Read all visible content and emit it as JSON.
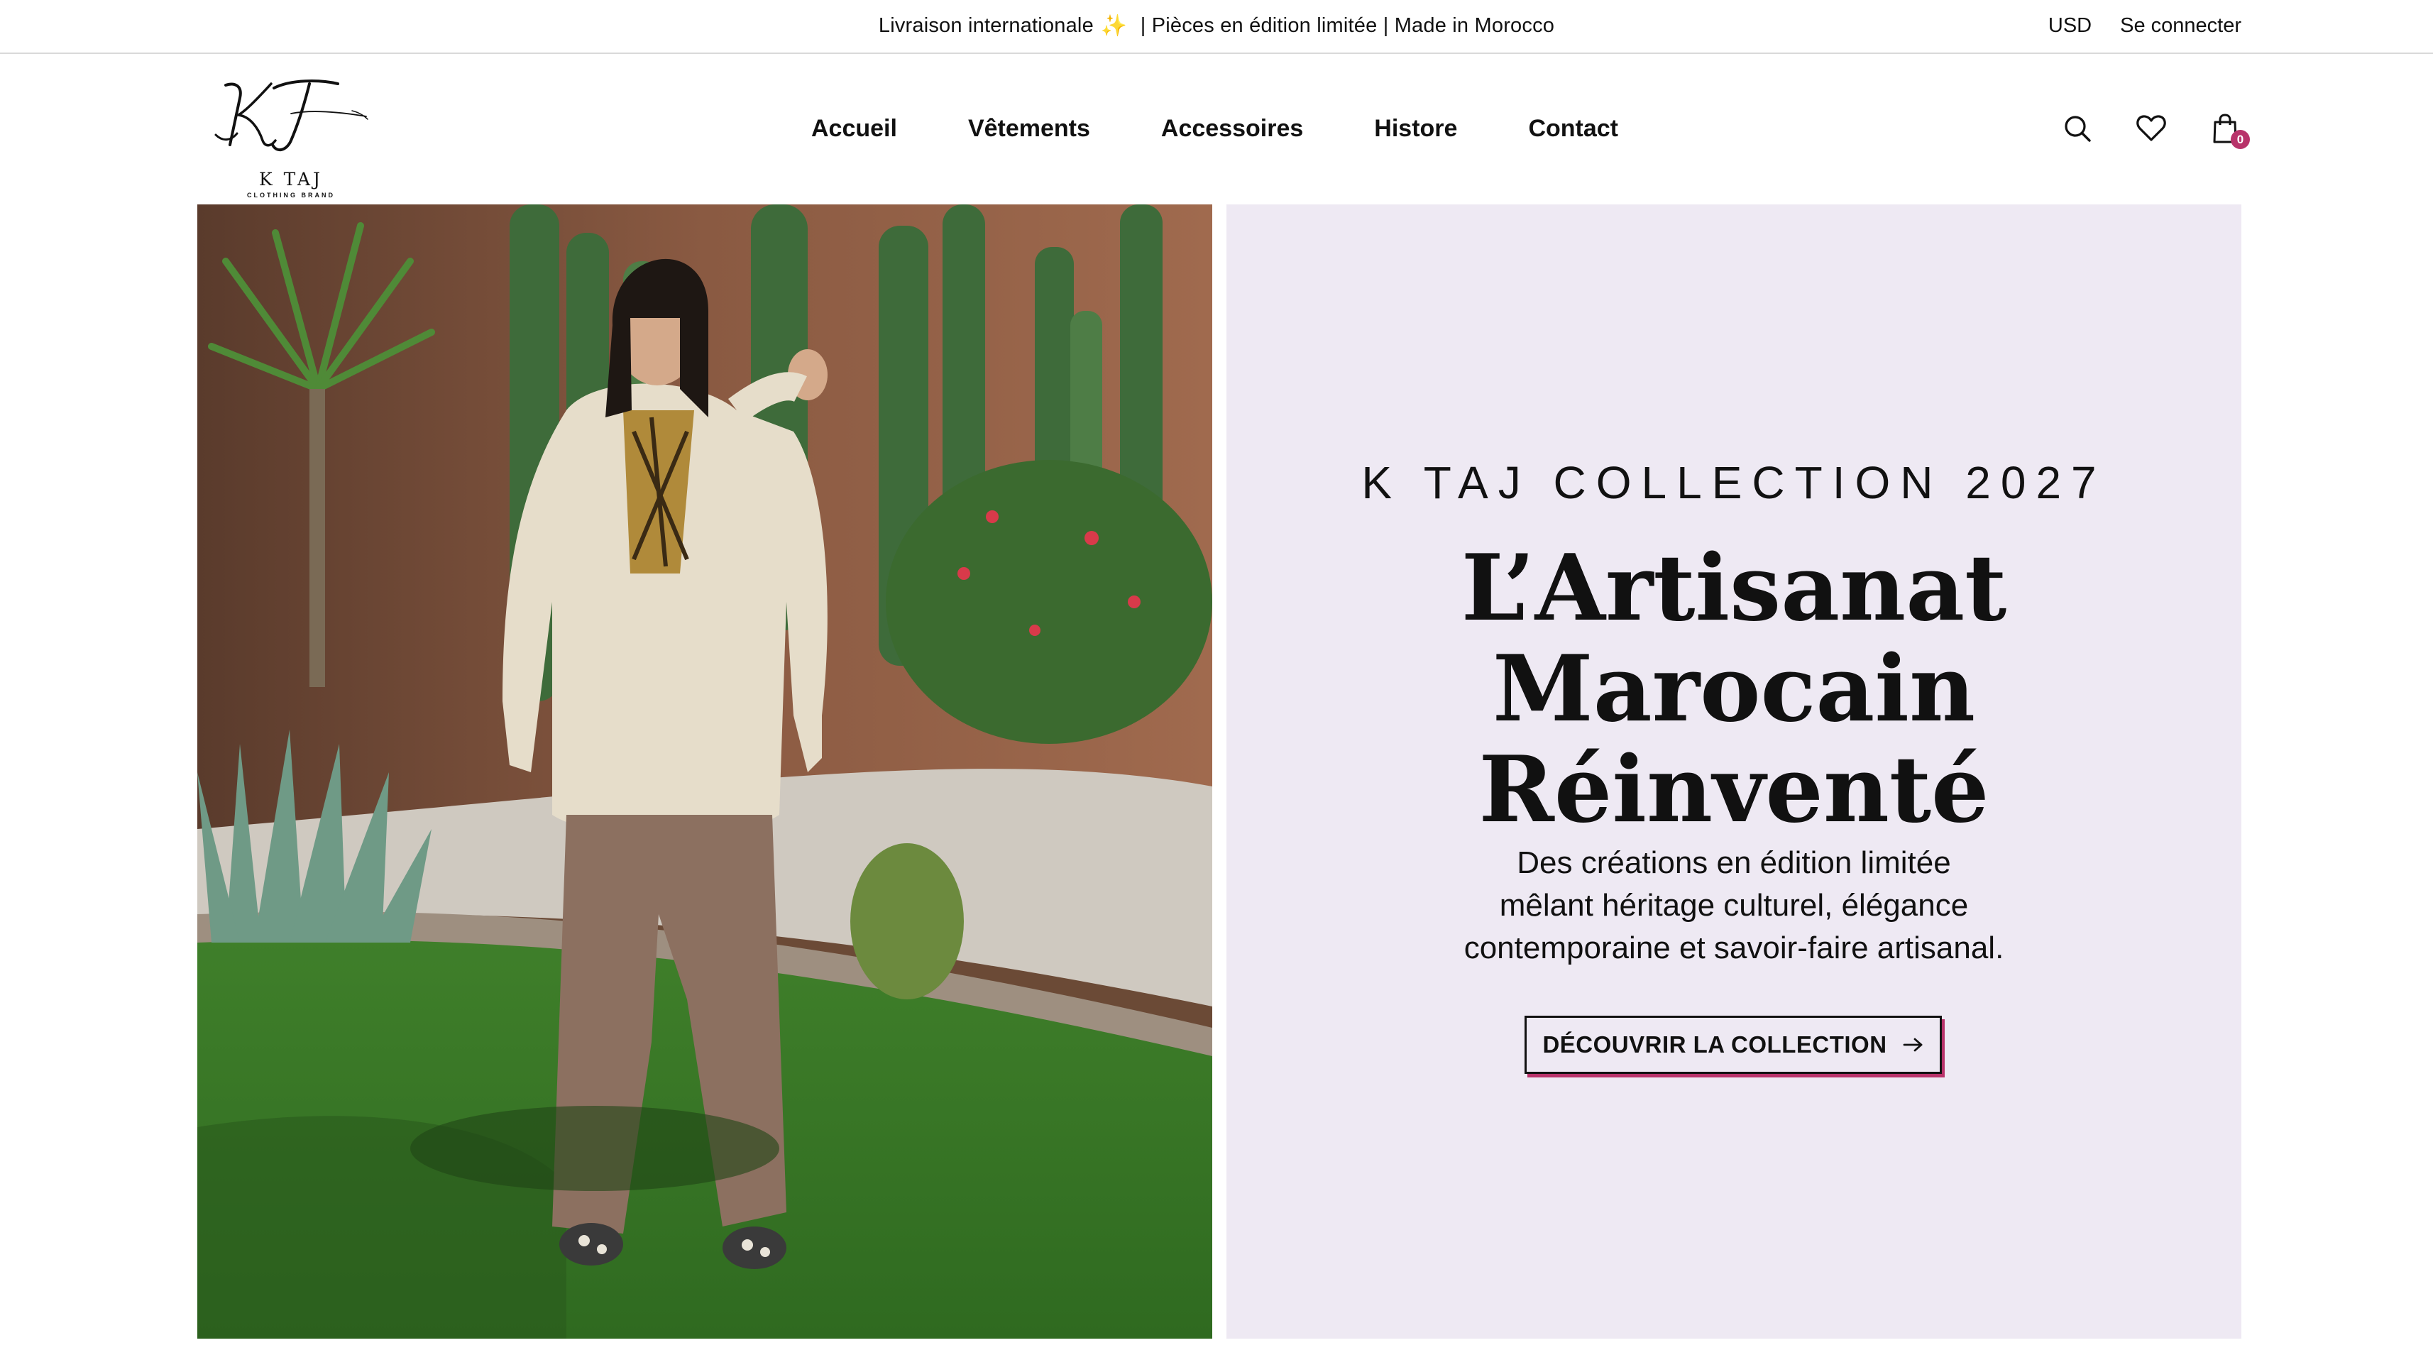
{
  "announcement": {
    "part1": "Livraison internationale",
    "sparkle": "✨",
    "part2": " | Pièces en édition limitée | Made in Morocco",
    "currency": "USD",
    "login": "Se connecter"
  },
  "logo": {
    "monogram": "KT",
    "name": "K TAJ",
    "tagline": "CLOTHING BRAND"
  },
  "nav": [
    {
      "label": "Accueil"
    },
    {
      "label": "Vêtements"
    },
    {
      "label": "Accessoires"
    },
    {
      "label": "Histore"
    },
    {
      "label": "Contact"
    }
  ],
  "icons": {
    "search": "search-icon",
    "wishlist": "heart-icon",
    "cart": "shopping-bag-icon",
    "cart_count": "0"
  },
  "hero": {
    "eyebrow": "K TAJ COLLECTION 2027",
    "headline_line1": "L’Artisanat Marocain",
    "headline_line2": "Réinventé",
    "desc_line1": "Des créations en édition limitée",
    "desc_line2": "mêlant héritage culturel, élégance",
    "desc_line3": "contemporaine et savoir-faire artisanal.",
    "cta_label": "DÉCOUVRIR LA COLLECTION",
    "cta_icon": "arrow-right-icon"
  },
  "colors": {
    "accent": "#b8336a",
    "panel_bg": "#eee9f3",
    "text": "#111111"
  }
}
